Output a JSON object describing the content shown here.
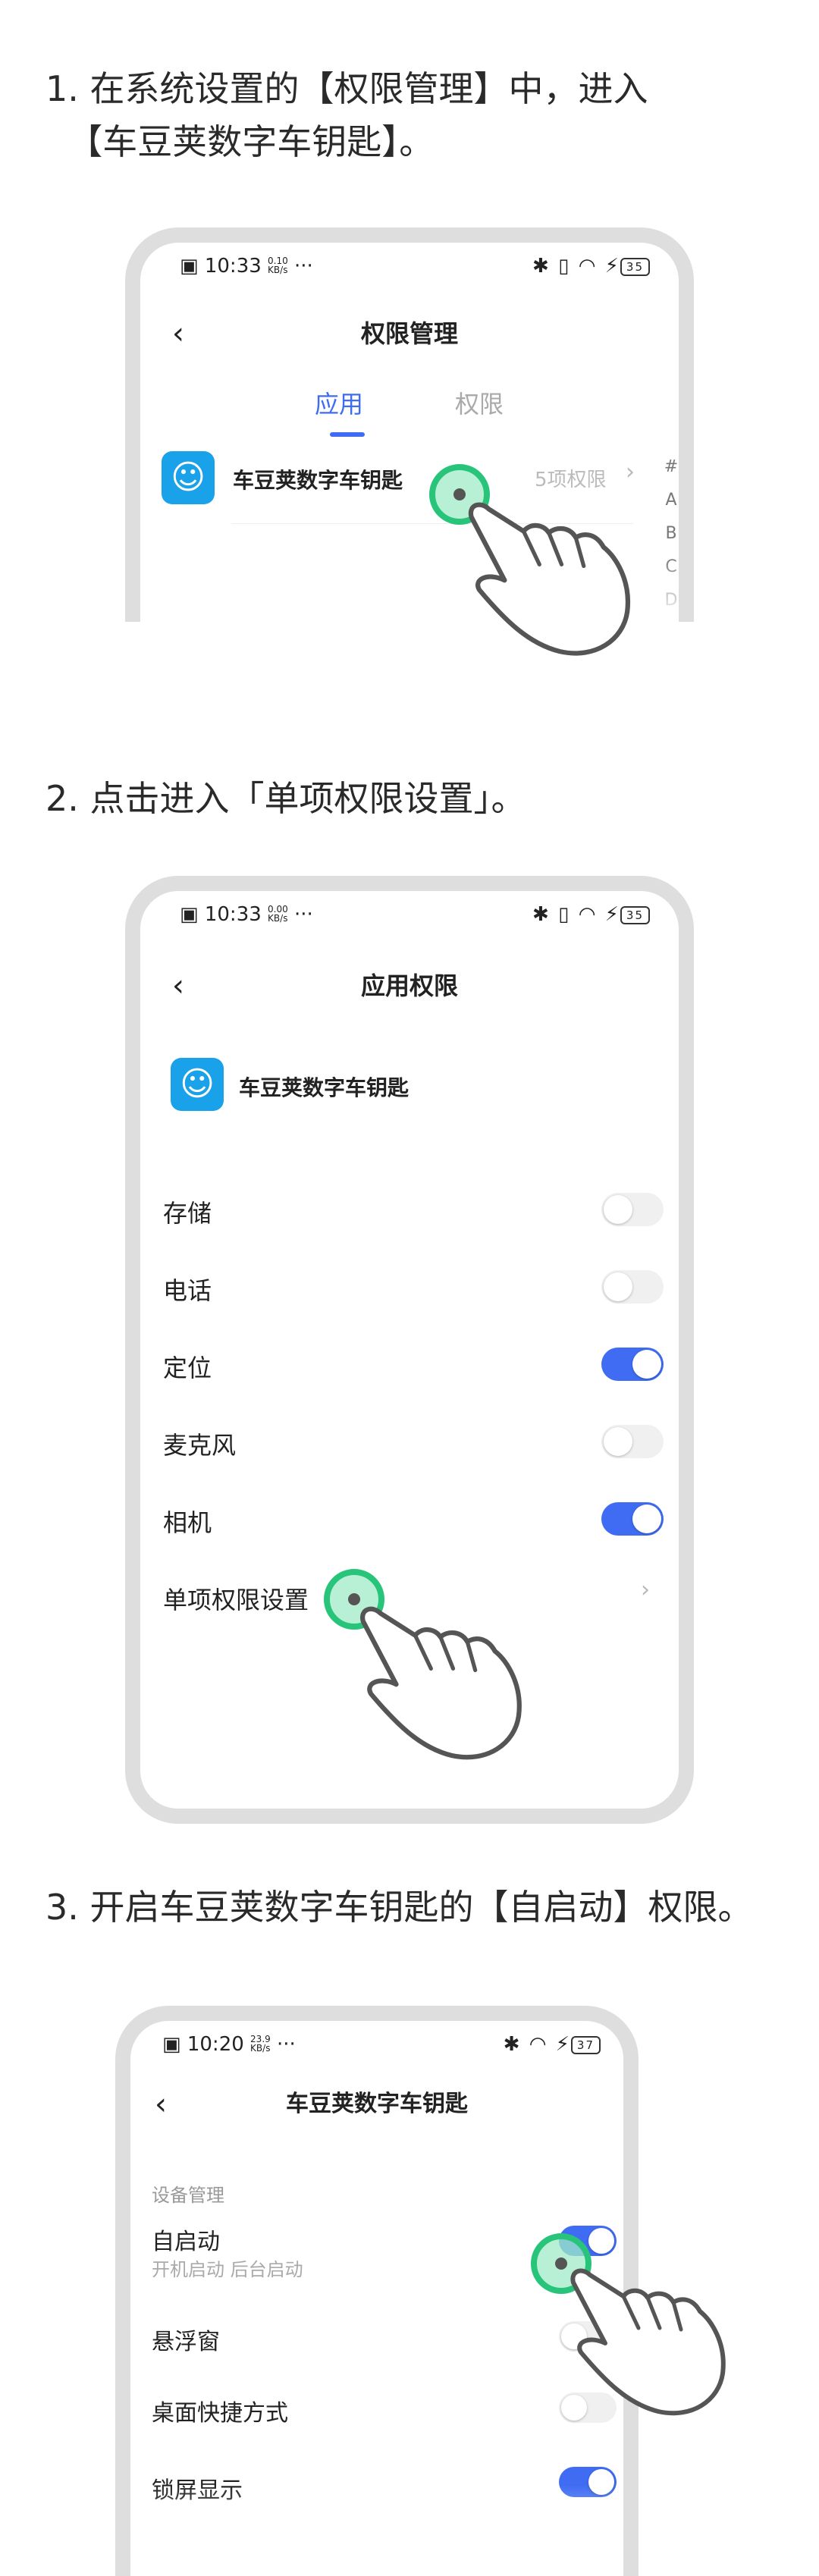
{
  "steps": [
    {
      "text": "1. 在系统设置的【权限管理】中，进入\n  【车豆荚数字车钥匙】。"
    },
    {
      "text": "2. 点击进入「单项权限设置」。"
    },
    {
      "text": "3. 开启车豆荚数字车钥匙的【自启动】权限。"
    }
  ],
  "phone1": {
    "status": {
      "time": "10:33",
      "speed_top": "0.10",
      "speed_bottom": "KB/s",
      "dots": "···",
      "battery": "35"
    },
    "nav_title": "权限管理",
    "tabs": [
      {
        "label": "应用",
        "active": true
      },
      {
        "label": "权限",
        "active": false
      }
    ],
    "app": {
      "name": "车豆荚数字车钥匙",
      "perm_count": "5项权限"
    },
    "index": [
      "#",
      "A",
      "B",
      "C",
      "D"
    ]
  },
  "phone2": {
    "status": {
      "time": "10:33",
      "speed_top": "0.00",
      "speed_bottom": "KB/s",
      "dots": "···",
      "battery": "35"
    },
    "nav_title": "应用权限",
    "app": {
      "name": "车豆荚数字车钥匙"
    },
    "rows": [
      {
        "label": "存储",
        "on": false
      },
      {
        "label": "电话",
        "on": false
      },
      {
        "label": "定位",
        "on": true
      },
      {
        "label": "麦克风",
        "on": false
      },
      {
        "label": "相机",
        "on": true
      }
    ],
    "single_setting": "单项权限设置"
  },
  "phone3": {
    "status": {
      "time": "10:20",
      "speed_top": "23.9",
      "speed_bottom": "KB/s",
      "dots": "···",
      "battery": "37"
    },
    "nav_title": "车豆荚数字车钥匙",
    "section": "设备管理",
    "rows": [
      {
        "label": "自启动",
        "sub": "开机启动  后台启动",
        "on": true
      },
      {
        "label": "悬浮窗",
        "on": false
      },
      {
        "label": "桌面快捷方式",
        "on": false
      },
      {
        "label": "锁屏显示",
        "on": true
      }
    ]
  },
  "icons": {
    "back": "chevron-left-icon",
    "tap": "tap-indicator-icon",
    "hand": "pointing-hand-icon",
    "chevron": "chevron-right-icon",
    "bluetooth": "bluetooth-icon",
    "wifi": "wifi-icon",
    "vibrate": "vibrate-icon",
    "battery": "battery-icon"
  },
  "colors": {
    "accent": "#3f6cf3",
    "tap_green": "#27c47a",
    "app_icon": "#19a1ea"
  }
}
